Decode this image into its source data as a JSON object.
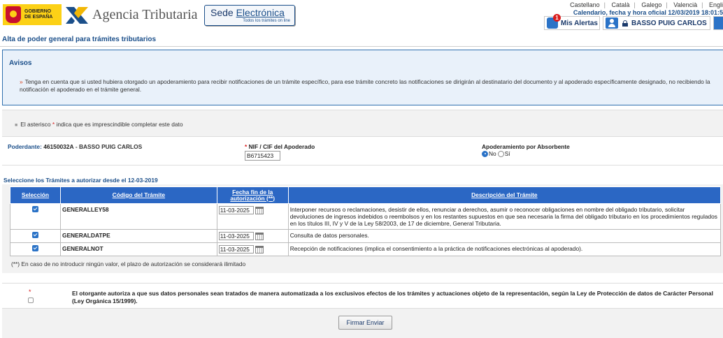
{
  "header": {
    "gov_logo_text": "GOBIERNO DE ESPAÑA",
    "agency_name": "Agencia Tributaria",
    "sede_title_1": "Sede",
    "sede_title_2": "Electrónica",
    "sede_subtitle": "Todos los trámites on line",
    "languages": [
      "Castellano",
      "Català",
      "Galego",
      "Valencià",
      "Engli"
    ],
    "clock_text": "Calendario, fecha y hora oficial 12/03/2019 18:01:5",
    "alerts_label": "Mis Alertas",
    "alerts_count": "1",
    "user_name": "BASSO PUIG CARLOS"
  },
  "page": {
    "title": "Alta de poder general para trámites tributarios"
  },
  "avisos": {
    "title": "Avisos",
    "text": "Tenga en cuenta que si usted hubiera otorgado un apoderamiento para recibir notificaciones de un trámite específico, para ese trámite concreto las notificaciones se dirigirán al destinatario del documento y al apoderado específicamente designado, no recibiendo la notificación el apoderado en el trámite general."
  },
  "required_note": {
    "prefix": "El asterisco",
    "star": "*",
    "suffix": "indica que es imprescindible completar este dato"
  },
  "poderdante": {
    "label": "Poderdante:",
    "nif": "46150032A",
    "name": "- BASSO PUIG CARLOS",
    "nif_label": "NIF / CIF del Apoderado",
    "nif_value": "B6715423",
    "absorbente_label": "Apoderamiento por Absorbente",
    "absorbente_options": [
      "No",
      "Sí"
    ],
    "absorbente_selected": "No"
  },
  "tramites": {
    "section_title": "Seleccione los Trámites a autorizar desde el 12-03-2019",
    "columns": [
      "Selección",
      "Código del Trámite",
      "Fecha fin de la autorización (**)",
      "Descripción del Trámite"
    ],
    "rows": [
      {
        "selected": true,
        "code": "GENERALLEY58",
        "date": "11-03-2025",
        "description": "Interponer recursos o reclamaciones, desistir de ellos, renunciar a derechos, asumir o reconocer obligaciones en nombre del obligado tributario, solicitar devoluciones de ingresos indebidos o reembolsos y en los restantes supuestos en que sea necesaria la firma del obligado tributario en los procedimientos regulados en los títulos III, IV y V de la Ley 58/2003, de 17 de diciembre, General Tributaria."
      },
      {
        "selected": true,
        "code": "GENERALDATPE",
        "date": "11-03-2025",
        "description": "Consulta de datos personales."
      },
      {
        "selected": true,
        "code": "GENERALNOT",
        "date": "11-03-2025",
        "description": "Recepción de notificaciones (implica el consentimiento a la práctica de notificaciones electrónicas al apoderado)."
      }
    ],
    "note": "(**) En caso de no introducir ningún valor, el plazo de autorización se considerará ilimitado"
  },
  "consent": {
    "star": "*",
    "checked": false,
    "text": "El otorgante autoriza a que sus datos personales sean tratados de manera automatizada a los exclusivos efectos de los trámites y actuaciones objeto de la representación, según la Ley de Protección de datos de Carácter Personal (Ley Orgánica 15/1999)."
  },
  "footer": {
    "submit_label": "Firmar Enviar"
  },
  "colors": {
    "brand_blue": "#1b4f8a",
    "table_header": "#2b67c4",
    "required_red": "#d91b1b",
    "notice_bg": "#e9f1fa"
  }
}
